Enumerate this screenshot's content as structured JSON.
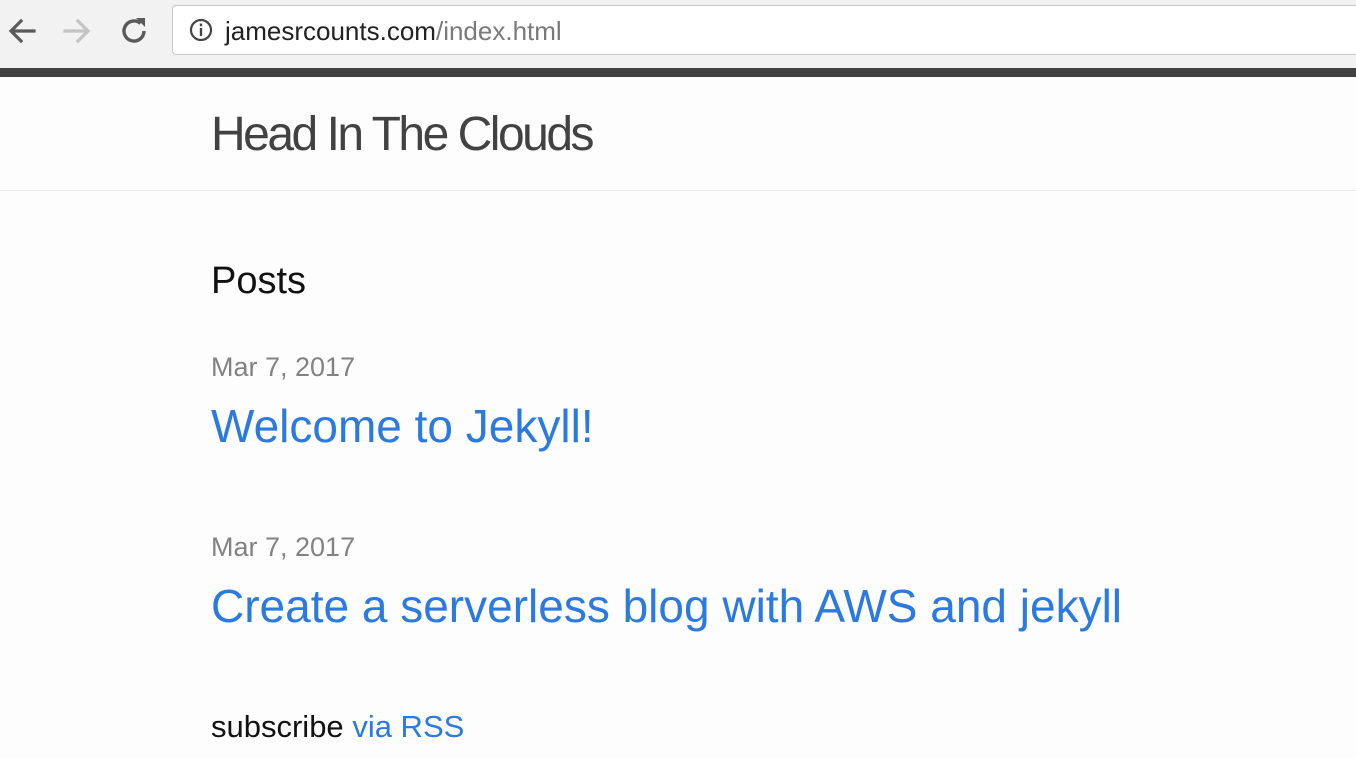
{
  "browser": {
    "url_host": "jamesrcounts.com",
    "url_path": "/index.html",
    "icons": {
      "back": "arrow-left-icon",
      "forward": "arrow-right-icon",
      "reload": "reload-icon",
      "site_info": "info-circle-icon"
    }
  },
  "site": {
    "title": "Head In The Clouds"
  },
  "main": {
    "heading": "Posts",
    "posts": [
      {
        "date": "Mar 7, 2017",
        "title": "Welcome to Jekyll!"
      },
      {
        "date": "Mar 7, 2017",
        "title": "Create a serverless blog with AWS and jekyll"
      }
    ],
    "subscribe_text": "subscribe",
    "rss_link": "via RSS"
  },
  "colors": {
    "link": "#2a7ae2",
    "meta": "#828282",
    "title": "#424242",
    "chrome_bar": "#424242"
  }
}
